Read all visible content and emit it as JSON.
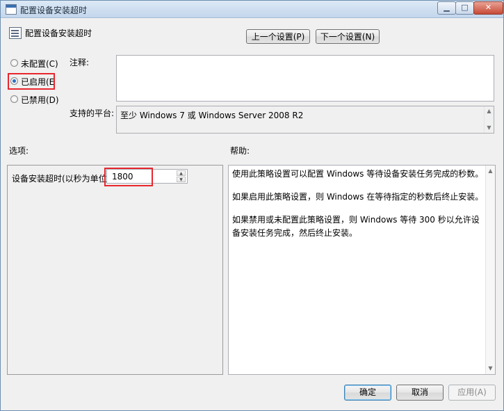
{
  "window": {
    "title": "配置设备安装超时",
    "controls": {
      "minimize": "▁",
      "maximize": "□",
      "close": "✕"
    }
  },
  "header": {
    "policy_name": "配置设备安装超时",
    "prev_label": "上一个设置(P)",
    "next_label": "下一个设置(N)"
  },
  "state": {
    "options": [
      {
        "label": "未配置(C)",
        "checked": false
      },
      {
        "label": "已启用(E",
        "checked": true
      },
      {
        "label": "已禁用(D)",
        "checked": false
      }
    ]
  },
  "comment": {
    "label": "注释:",
    "value": ""
  },
  "platform": {
    "label": "支持的平台:",
    "value": "至少 Windows 7 或 Windows Server 2008 R2"
  },
  "options_section": {
    "label": "选项:",
    "timeout_label": "设备安装超时(以秒为单位)",
    "timeout_value": "1800"
  },
  "help_section": {
    "label": "帮助:",
    "paragraphs": [
      "使用此策略设置可以配置 Windows 等待设备安装任务完成的秒数。",
      "如果启用此策略设置，则 Windows 在等待指定的秒数后终止安装。",
      "如果禁用或未配置此策略设置，则 Windows 等待 300 秒以允许设备安装任务完成，然后终止安装。"
    ]
  },
  "footer": {
    "ok_label": "确定",
    "cancel_label": "取消",
    "apply_label": "应用(A)"
  },
  "colors": {
    "highlight": "#e8262d",
    "accent": "#3c7fb1"
  }
}
